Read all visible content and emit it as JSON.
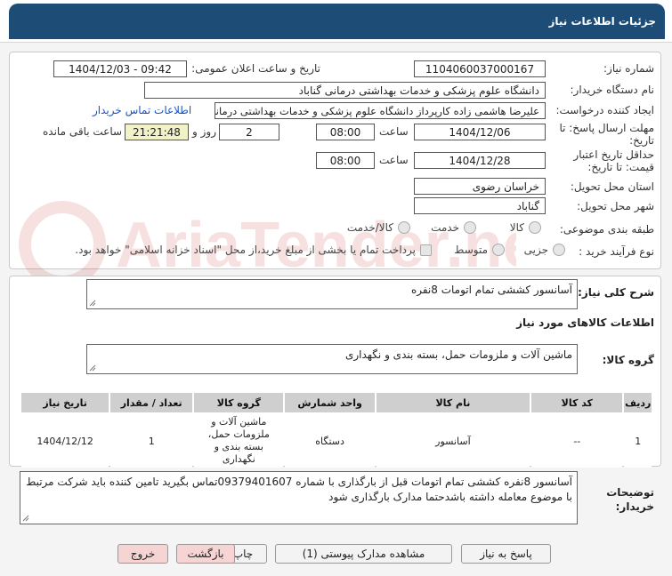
{
  "header": {
    "title": "جزئیات اطلاعات نیاز"
  },
  "form": {
    "need_number_label": "شماره نیاز:",
    "need_number": "1104060037000167",
    "announce_label": "تاریخ و ساعت اعلان عمومی:",
    "announce_value": "1404/12/03 - 09:42",
    "buyer_org_label": "نام دستگاه خریدار:",
    "buyer_org": "دانشگاه علوم پزشکی و خدمات بهداشتی درمانی گناباد",
    "creator_label": "ایجاد کننده درخواست:",
    "creator": "علیرضا هاشمی زاده کارپرداز دانشگاه علوم پزشکی و خدمات بهداشتی درمانی",
    "contact_link": "اطلاعات تماس خریدار",
    "deadline_label": "مهلت ارسال پاسخ: تا تاریخ:",
    "deadline_date": "1404/12/06",
    "time_label": "ساعت",
    "deadline_time": "08:00",
    "days_value": "2",
    "days_label": "روز و",
    "remaining_time": "21:21:48",
    "remaining_label": "ساعت باقی مانده",
    "validity_label": "حداقل تاریخ اعتبار قیمت: تا تاریخ:",
    "validity_date": "1404/12/28",
    "validity_time": "08:00",
    "province_label": "استان محل تحویل:",
    "province": "خراسان رضوی",
    "city_label": "شهر محل تحویل:",
    "city": "گناباد",
    "category_label": "طبقه بندی موضوعی:",
    "category_options": [
      "کالا",
      "خدمت",
      "کالا/خدمت"
    ],
    "process_label": "نوع فرآیند خرید :",
    "process_options": [
      "جزیی",
      "متوسط"
    ],
    "payment_note": "پرداخت تمام یا بخشی از مبلغ خرید،از محل \"اسناد خزانه اسلامی\" خواهد بود."
  },
  "description": {
    "label": "شرح کلی نیاز:",
    "value": "آسانسور کششی تمام اتومات 8نفره"
  },
  "goods": {
    "section_title": "اطلاعات کالاهای مورد نیاز",
    "group_label": "گروه کالا:",
    "group_value": "ماشین آلات و ملزومات حمل، بسته بندی و نگهداری",
    "table": {
      "headers": [
        "ردیف",
        "کد کالا",
        "نام کالا",
        "واحد شمارش",
        "گروه کالا",
        "تعداد / مقدار",
        "تاریخ نیاز"
      ],
      "rows": [
        {
          "row": "1",
          "code": "--",
          "name": "آسانسور",
          "unit": "دستگاه",
          "group": "ماشین آلات و ملزومات حمل، بسته بندی و نگهداری",
          "qty": "1",
          "date": "1404/12/12"
        }
      ]
    }
  },
  "buyer_notes": {
    "label": "توضیحات خریدار:",
    "value": "آسانسور 8نفره کششی تمام اتومات  قبل از بارگذاری با شماره 09379401607تماس بگیرید تامین کننده باید شرکت مرتبط با موضوع معامله داشته باشدحتما مدارک بارگذاری شود"
  },
  "buttons": {
    "reply": "پاسخ به نیاز",
    "attachments": "مشاهده مدارک پیوستی (1)",
    "print": "چاپ",
    "back": "بازگشت",
    "exit": "خروج"
  },
  "watermark": {
    "text": "AriaTender.neT"
  },
  "colors": {
    "title_bar": "#1d4d77",
    "link": "#1a55c4",
    "timer_bg": "#f2f2c8",
    "pink_button": "#f7d4d4"
  }
}
